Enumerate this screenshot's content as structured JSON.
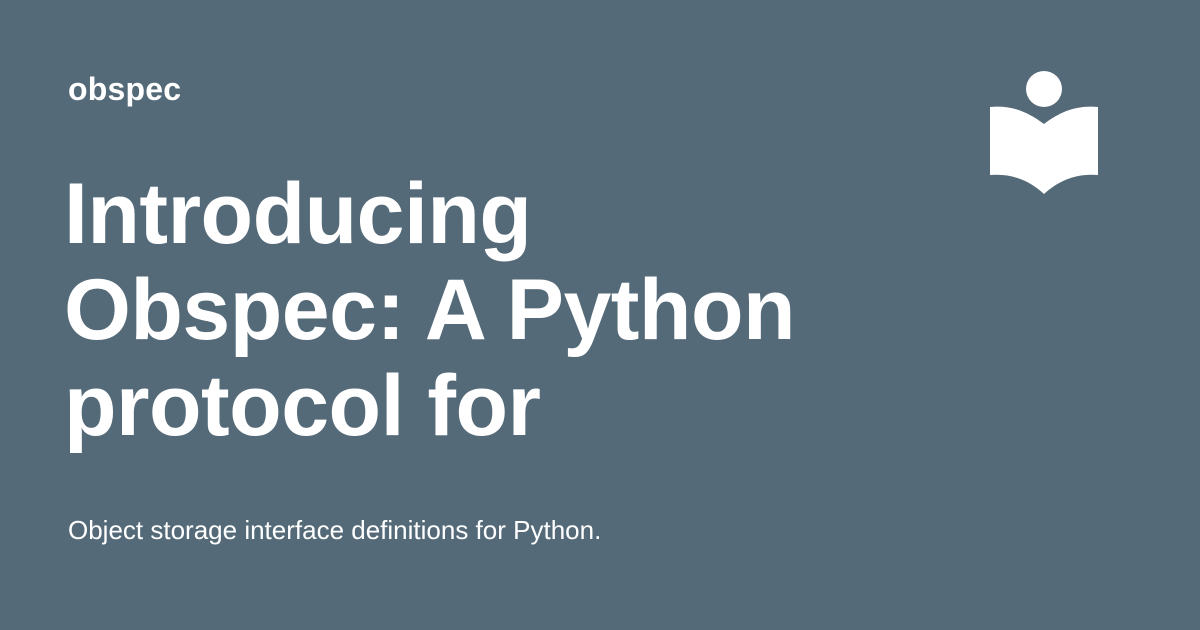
{
  "site": {
    "name": "obspec"
  },
  "post": {
    "title": "Introducing Obspec: A Python protocol for",
    "description": "Object storage interface definitions for Python."
  },
  "logo": {
    "icon": "reader-book-icon",
    "color": "#ffffff"
  },
  "theme": {
    "background": "#546a78",
    "text": "#ffffff"
  }
}
